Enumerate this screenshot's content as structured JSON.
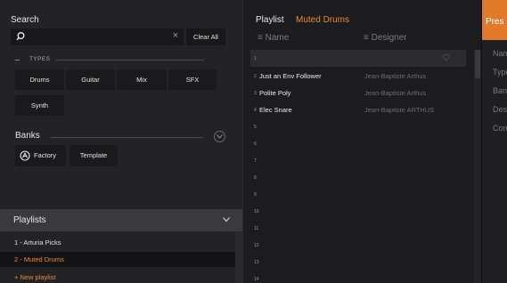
{
  "search": {
    "title": "Search",
    "value": "",
    "clear_all_label": "Clear All"
  },
  "types": {
    "label": "TYPES",
    "items": [
      "Drums",
      "Guitar",
      "Mix",
      "SFX",
      "Synth"
    ]
  },
  "banks": {
    "title": "Banks",
    "items": [
      "Factory",
      "Template"
    ]
  },
  "playlists": {
    "title": "Playlists",
    "items": [
      {
        "label": "1 - Arturia Picks",
        "selected": false
      },
      {
        "label": "2 - Muted Drums",
        "selected": true
      }
    ],
    "new_label": "+ New playlist"
  },
  "playlist_panel": {
    "title": "Playlist",
    "name": "Muted Drums",
    "col_name": "≡ Name",
    "col_designer": "≡ Designer",
    "rows": [
      {
        "num": "1",
        "name": "",
        "designer": ""
      },
      {
        "num": "2",
        "name": "Just an Env Follower",
        "designer": "Jean-Baptiste Arthus"
      },
      {
        "num": "3",
        "name": "Polite Poly",
        "designer": "Jean-Baptiste Arthus"
      },
      {
        "num": "4",
        "name": "Elec Snare",
        "designer": "Jean-Baptiste ARTHUS"
      },
      {
        "num": "5",
        "name": "",
        "designer": ""
      },
      {
        "num": "6",
        "name": "",
        "designer": ""
      },
      {
        "num": "7",
        "name": "",
        "designer": ""
      },
      {
        "num": "8",
        "name": "",
        "designer": ""
      },
      {
        "num": "9",
        "name": "",
        "designer": ""
      },
      {
        "num": "10",
        "name": "",
        "designer": ""
      },
      {
        "num": "11",
        "name": "",
        "designer": ""
      },
      {
        "num": "12",
        "name": "",
        "designer": ""
      },
      {
        "num": "13",
        "name": "",
        "designer": ""
      },
      {
        "num": "14",
        "name": "",
        "designer": ""
      }
    ]
  },
  "preset_panel": {
    "title": "Pres",
    "labels": [
      "Nam",
      "Type",
      "Ban",
      "Des",
      "Com"
    ]
  },
  "colors": {
    "accent": "#e88a3a",
    "header_accent": "#e07a2a"
  }
}
